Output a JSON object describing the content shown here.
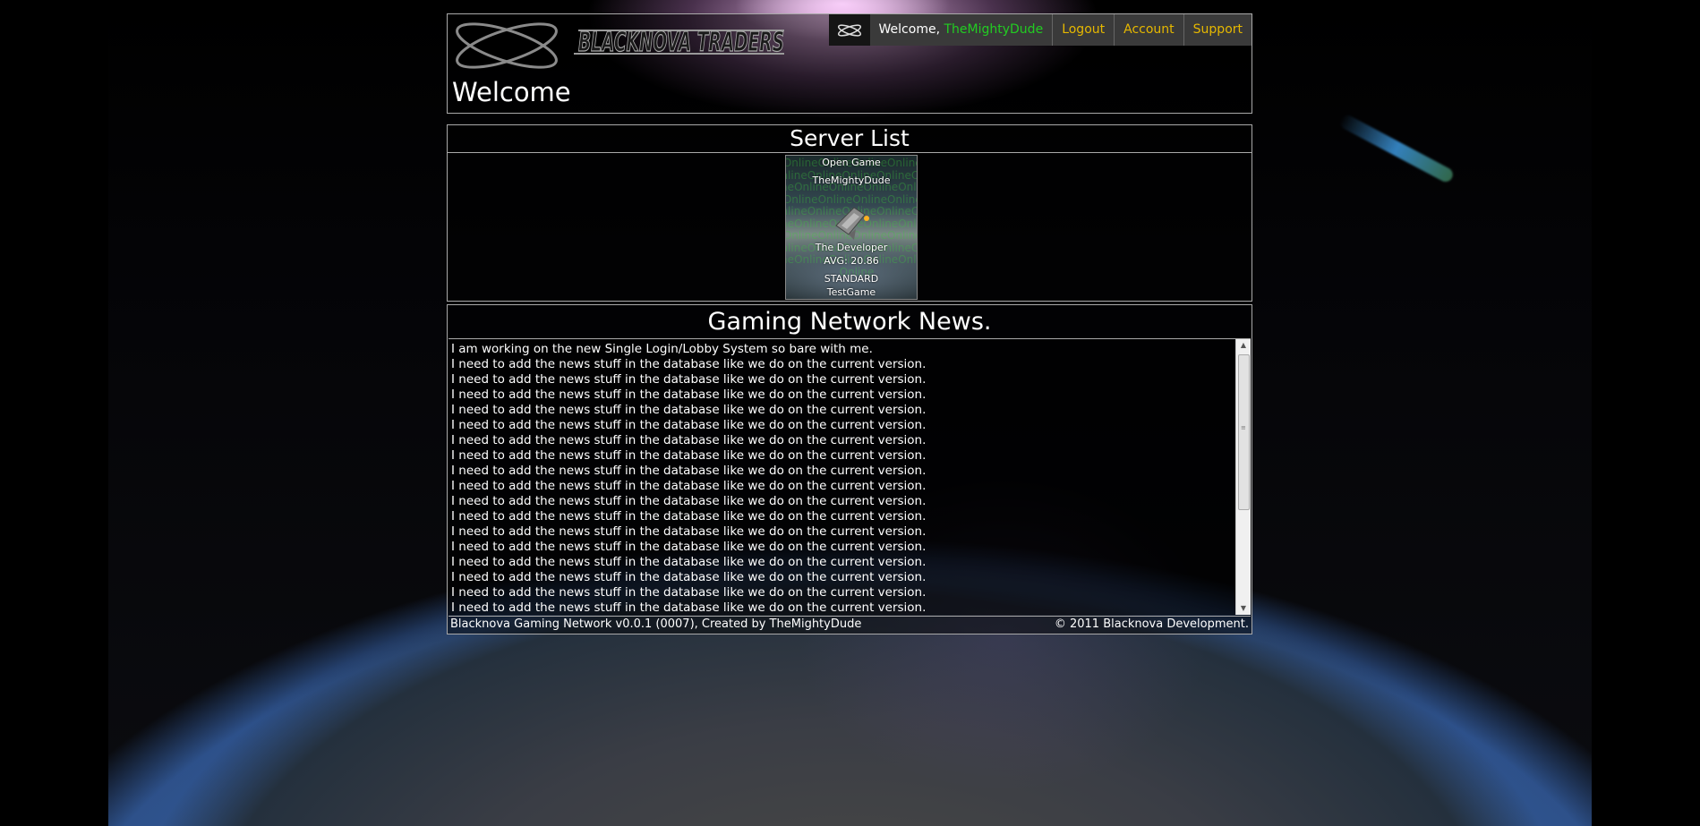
{
  "header": {
    "logo_text": "BLACKNOVA TRADERS",
    "page_title": "Welcome",
    "nav": {
      "welcome_prefix": "Welcome,",
      "username": "TheMightyDude",
      "links": [
        "Logout",
        "Account",
        "Support"
      ]
    }
  },
  "servers": {
    "title": "Server List",
    "card": {
      "status": "Open Game",
      "owner": "TheMightyDude",
      "developer": "The Developer",
      "avg": "AVG: 20.86",
      "type": "STANDARD",
      "name": "TestGame",
      "bg_text": "Online"
    }
  },
  "news": {
    "title": "Gaming Network News.",
    "first_line": "I am working on the new Single Login/Lobby System so bare with me.",
    "repeat_line": "I need to add the news stuff in the database like we do on the current version.",
    "repeat_count": 17
  },
  "footer": {
    "left": "Blacknova Gaming Network v0.0.1 (0007), Created by TheMightyDude",
    "right": "© 2011 Blacknova Development."
  },
  "colors": {
    "username": "#22cc22",
    "nav_link": "#e6b800",
    "border": "#a9a9a9"
  }
}
